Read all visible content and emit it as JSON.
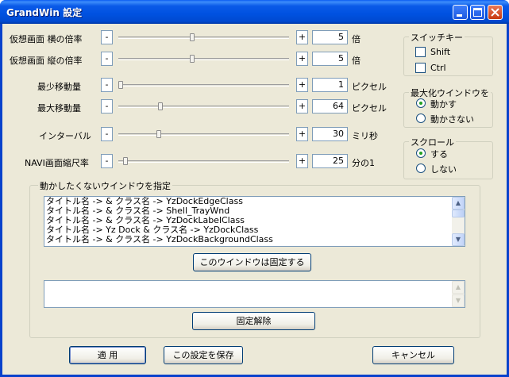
{
  "window": {
    "title": "GrandWin 設定"
  },
  "sliders": [
    {
      "label": "仮想画面  横の倍率",
      "value": "5",
      "unit": "倍",
      "fraction": 0.43
    },
    {
      "label": "仮想画面  縦の倍率",
      "value": "5",
      "unit": "倍",
      "fraction": 0.43
    },
    {
      "label": "最少移動量",
      "value": "1",
      "unit": "ピクセル",
      "fraction": 0.0
    },
    {
      "label": "最大移動量",
      "value": "64",
      "unit": "ピクセル",
      "fraction": 0.24
    },
    {
      "label": "インターバル",
      "value": "30",
      "unit": "ミリ秒",
      "fraction": 0.23
    },
    {
      "label": "NAVI画面縮尺率",
      "value": "25",
      "unit": "分の1",
      "fraction": 0.03
    }
  ],
  "slider_buttons": {
    "minus": "-",
    "plus": "+"
  },
  "switch_key": {
    "title": "スイッチキー",
    "shift": "Shift",
    "ctrl": "Ctrl"
  },
  "maximized": {
    "title": "最大化ウインドウを",
    "move": "動かす",
    "no_move": "動かさない"
  },
  "scroll": {
    "title": "スクロール",
    "yes": "する",
    "no": "しない"
  },
  "exclude": {
    "title": "動かしたくないウインドウを指定",
    "list": [
      "タイトル名 ->  & クラス名 -> YzDockEdgeClass",
      "タイトル名 ->  & クラス名 -> Shell_TrayWnd",
      "タイトル名 ->  & クラス名 -> YzDockLabelClass",
      "タイトル名 -> Yz Dock & クラス名 -> YzDockClass",
      "タイトル名 ->  & クラス名 -> YzDockBackgroundClass"
    ],
    "fix_button": "このウインドウは固定する",
    "unfix_button": "固定解除"
  },
  "footer": {
    "apply": "適  用",
    "save": "この設定を保存",
    "cancel": "キャンセル"
  }
}
